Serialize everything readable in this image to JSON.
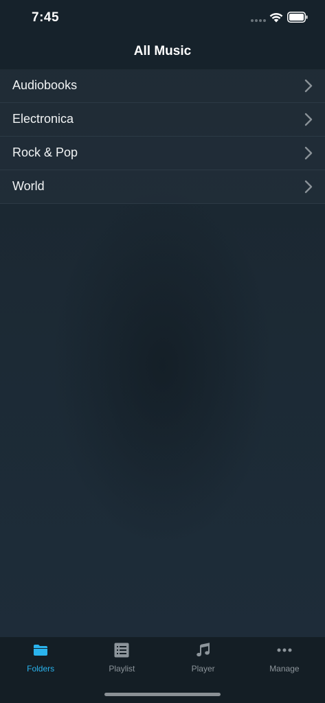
{
  "status_bar": {
    "time": "7:45",
    "icons": [
      "signal-dots-icon",
      "wifi-icon",
      "battery-icon"
    ]
  },
  "nav": {
    "title": "All Music"
  },
  "folders": [
    {
      "label": "Audiobooks",
      "icon": "chevron-right-icon"
    },
    {
      "label": "Electronica",
      "icon": "chevron-right-icon"
    },
    {
      "label": "Rock & Pop",
      "icon": "chevron-right-icon"
    },
    {
      "label": "World",
      "icon": "chevron-right-icon"
    }
  ],
  "tab_bar": {
    "tabs": [
      {
        "label": "Folders",
        "icon": "folder-icon",
        "active": true
      },
      {
        "label": "Playlist",
        "icon": "playlist-icon",
        "active": false
      },
      {
        "label": "Player",
        "icon": "music-note-icon",
        "active": false
      },
      {
        "label": "Manage",
        "icon": "more-icon",
        "active": false
      }
    ]
  },
  "colors": {
    "accent": "#2ab4ee",
    "inactive_tab": "#8d959b",
    "background": "#1b2630"
  }
}
